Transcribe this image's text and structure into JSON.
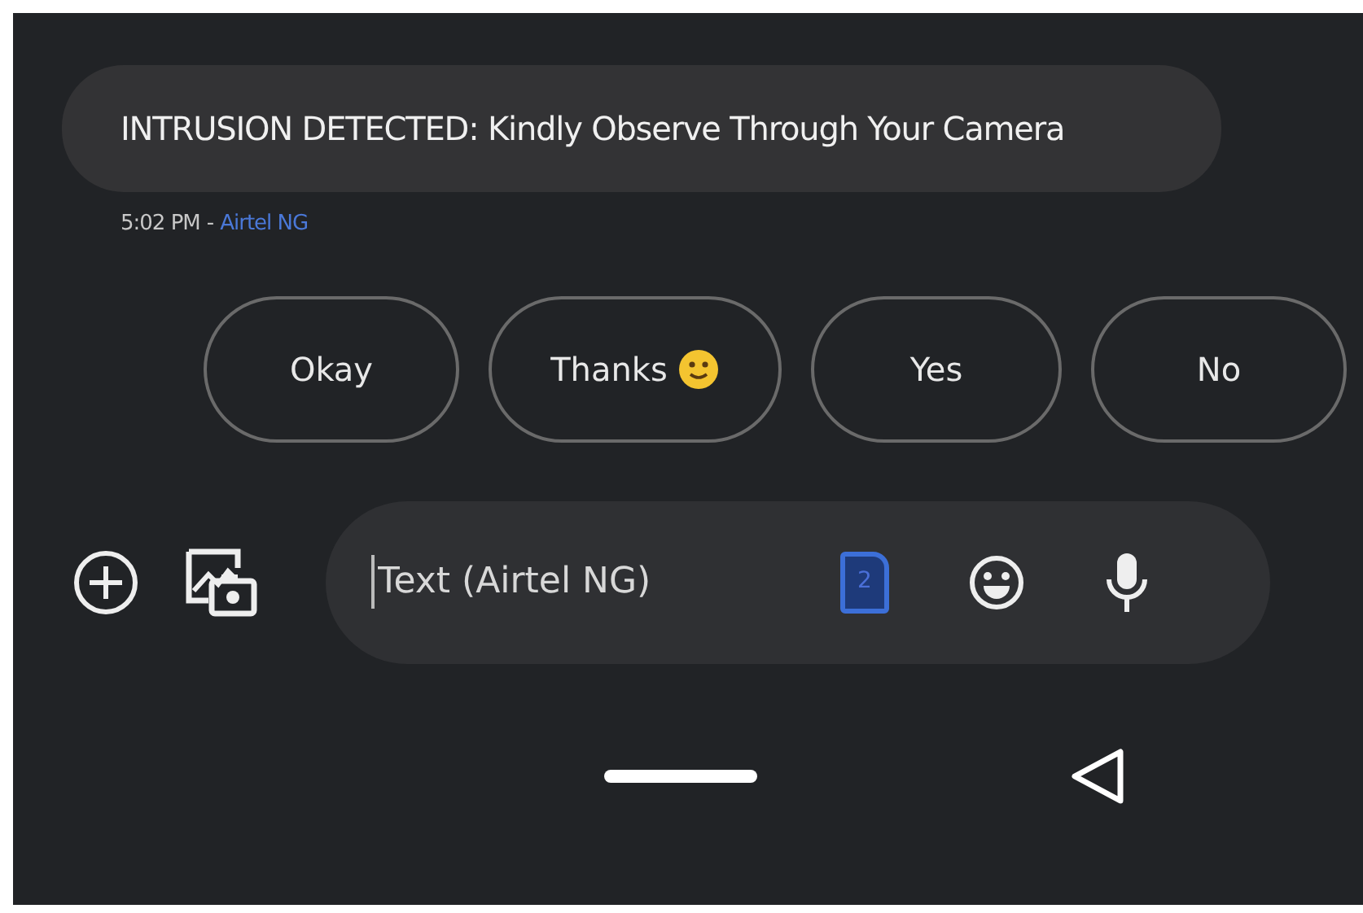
{
  "message": {
    "text": "INTRUSION DETECTED: Kindly Observe Through Your Camera",
    "time": "5:02 PM",
    "separator": "-",
    "sender": "Airtel NG"
  },
  "suggestions": [
    {
      "label": "Okay",
      "emoji": false
    },
    {
      "label": "Thanks",
      "emoji": true
    },
    {
      "label": "Yes",
      "emoji": false
    },
    {
      "label": "No",
      "emoji": false
    }
  ],
  "composer": {
    "placeholder": "Text (Airtel NG)",
    "sim": "2"
  }
}
